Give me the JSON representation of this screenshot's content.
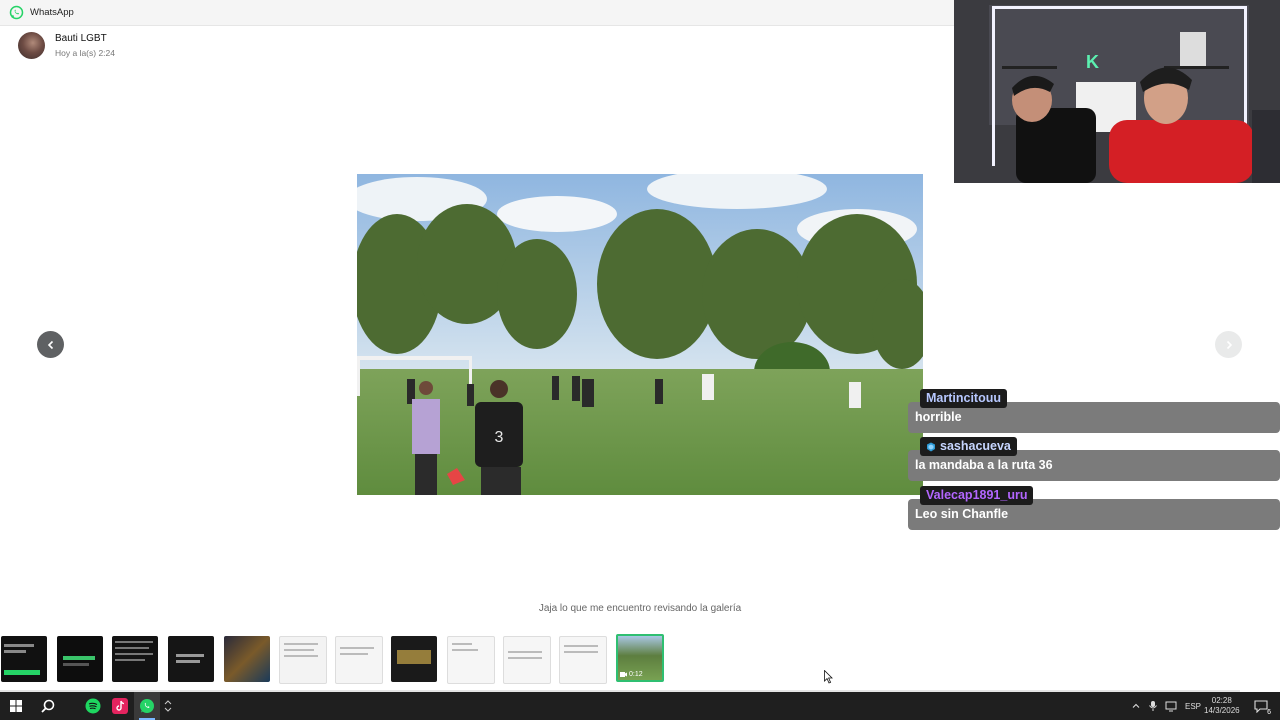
{
  "window": {
    "title": "WhatsApp"
  },
  "message": {
    "sender": "Bauti LGBT",
    "time": "Hoy a la(s) 2:24",
    "caption": "Jaja lo que me encuentro revisando la galería"
  },
  "media": {
    "type": "video"
  },
  "gallery": {
    "selected_index": 11,
    "selected_duration": "0:12",
    "thumbnails": [
      "screenshot",
      "screenshot",
      "document",
      "screenshot",
      "photo",
      "document",
      "document",
      "photo",
      "document",
      "document",
      "document",
      "video"
    ]
  },
  "chat_overlay": [
    {
      "user": "Martincitouu",
      "message": "horrible",
      "name_color": "#b7c8ff",
      "badge": ""
    },
    {
      "user": "sashacueva",
      "message": "la mandaba a la ruta 36",
      "name_color": "#c7d6ff",
      "badge": "badge-icon"
    },
    {
      "user": "Valecap1891_uru",
      "message": "Leo sin Chanfle",
      "name_color": "#b366ff",
      "badge": ""
    }
  ],
  "taskbar": {
    "apps": [
      "windows-start-icon",
      "search-icon",
      "spotify-icon",
      "tiktok-icon",
      "whatsapp-icon"
    ],
    "language": "ESP",
    "clock_time": "02:28",
    "clock_date": "14/3/2026",
    "notification_count": "6"
  },
  "colors": {
    "accent_green": "#25d366",
    "selected_border": "#2fbf71",
    "chat_bubble": "#7b7b7b",
    "taskbar": "#1f1f1f"
  }
}
